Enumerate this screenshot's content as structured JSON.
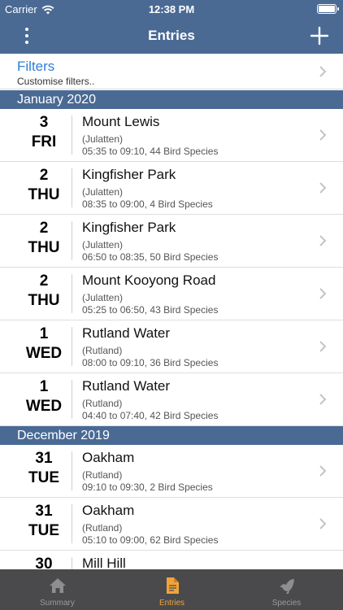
{
  "status": {
    "carrier": "Carrier",
    "time": "12:38 PM"
  },
  "nav": {
    "title": "Entries"
  },
  "filters": {
    "title": "Filters",
    "subtitle": "Customise filters.."
  },
  "sections": [
    {
      "header": "January 2020",
      "rows": [
        {
          "day": "3",
          "dow": "FRI",
          "place": "Mount Lewis",
          "region": "(Julatten)",
          "detail": "05:35 to 09:10, 44 Bird Species"
        },
        {
          "day": "2",
          "dow": "THU",
          "place": "Kingfisher Park",
          "region": "(Julatten)",
          "detail": "08:35 to 09:00, 4 Bird Species"
        },
        {
          "day": "2",
          "dow": "THU",
          "place": "Kingfisher Park",
          "region": "(Julatten)",
          "detail": "06:50 to 08:35, 50 Bird Species"
        },
        {
          "day": "2",
          "dow": "THU",
          "place": "Mount Kooyong Road",
          "region": "(Julatten)",
          "detail": "05:25 to 06:50, 43 Bird Species"
        },
        {
          "day": "1",
          "dow": "WED",
          "place": "Rutland Water",
          "region": "(Rutland)",
          "detail": "08:00 to 09:10, 36 Bird Species"
        },
        {
          "day": "1",
          "dow": "WED",
          "place": "Rutland Water",
          "region": "(Rutland)",
          "detail": "04:40 to 07:40, 42 Bird Species"
        }
      ]
    },
    {
      "header": "December 2019",
      "rows": [
        {
          "day": "31",
          "dow": "TUE",
          "place": "Oakham",
          "region": "(Rutland)",
          "detail": "09:10 to 09:30, 2 Bird Species"
        },
        {
          "day": "31",
          "dow": "TUE",
          "place": "Oakham",
          "region": "(Rutland)",
          "detail": "05:10 to 09:00, 62 Bird Species"
        },
        {
          "day": "30",
          "dow": "",
          "place": "Mill Hill",
          "region": "",
          "detail": ""
        }
      ]
    }
  ],
  "tabs": [
    {
      "label": "Summary",
      "icon": "home-icon"
    },
    {
      "label": "Entries",
      "icon": "document-icon",
      "active": true
    },
    {
      "label": "Species",
      "icon": "bird-icon"
    }
  ],
  "colors": {
    "bar": "#4a6a94",
    "link": "#2f7fd6",
    "active_tab": "#f0a43a",
    "tab_bar": "#4a4a4c"
  }
}
